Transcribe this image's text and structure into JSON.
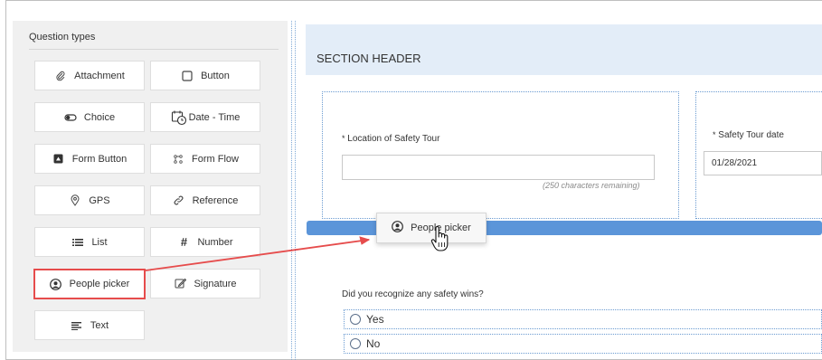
{
  "panel": {
    "title": "Question types",
    "items": [
      {
        "label": "Attachment",
        "icon": "paperclip-icon"
      },
      {
        "label": "Button",
        "icon": "checkbox-square-icon"
      },
      {
        "label": "Choice",
        "icon": "toggle-icon"
      },
      {
        "label": "Date - Time",
        "icon": "calendar-clock-icon"
      },
      {
        "label": "Form Button",
        "icon": "form-button-icon"
      },
      {
        "label": "Form Flow",
        "icon": "form-flow-icon"
      },
      {
        "label": "GPS",
        "icon": "map-pin-icon"
      },
      {
        "label": "Reference",
        "icon": "link-icon"
      },
      {
        "label": "List",
        "icon": "list-icon"
      },
      {
        "label": "Number",
        "icon": "hash-icon"
      },
      {
        "label": "People picker",
        "icon": "person-circle-icon"
      },
      {
        "label": "Signature",
        "icon": "signature-edit-icon"
      },
      {
        "label": "Text",
        "icon": "text-lines-icon"
      }
    ]
  },
  "canvas": {
    "section_header": "SECTION HEADER",
    "location": {
      "required_mark": "*",
      "label": "Location of Safety Tour",
      "value": "",
      "remaining": "(250 characters remaining)"
    },
    "tour_date": {
      "required_mark": "*",
      "label": "Safety Tour date",
      "value": "01/28/2021"
    },
    "drag_chip": {
      "label": "People picker",
      "icon": "person-circle-icon"
    },
    "question": {
      "label": "Did you recognize any safety wins?",
      "options": [
        "Yes",
        "No"
      ]
    }
  },
  "colors": {
    "highlight": "#e64c4c",
    "drop_bar": "#5b95d9",
    "section_bg": "#e3edf8",
    "panel_bg": "#f0f0f0"
  }
}
